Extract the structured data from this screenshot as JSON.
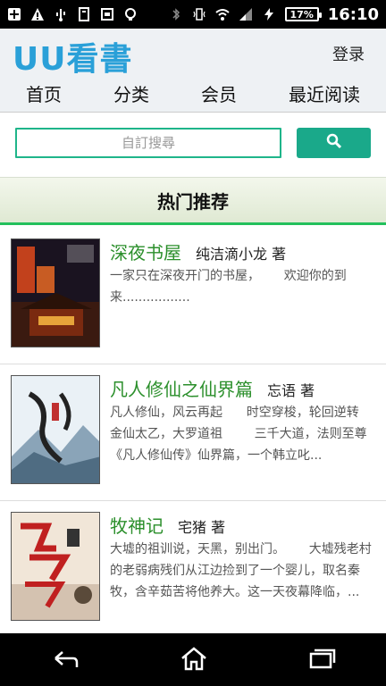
{
  "statusbar": {
    "battery": "17%",
    "time": "16:10"
  },
  "header": {
    "logo": "UU看書",
    "login": "登录"
  },
  "nav": {
    "items": [
      "首页",
      "分类",
      "会员",
      "最近阅读"
    ]
  },
  "search": {
    "placeholder": "自訂搜尋"
  },
  "section": {
    "title": "热门推荐"
  },
  "books": [
    {
      "title": "深夜书屋",
      "author": "纯洁滴小龙 著",
      "desc": "一家只在深夜开门的书屋，      欢迎你的到来................."
    },
    {
      "title": "凡人修仙之仙界篇",
      "author": "忘语 著",
      "desc": "凡人修仙，风云再起      时空穿梭，轮回逆转        金仙太乙，大罗道祖        三千大道，法则至尊      《凡人修仙传》仙界篇，一个韩立叱..."
    },
    {
      "title": "牧神记",
      "author": "宅猪 著",
      "desc": "大墟的祖训说，天黑，别出门。      大墟残老村的老弱病残们从江边捡到了一个婴儿，取名秦牧，含辛茹苦将他养大。这一天夜幕降临，..."
    }
  ]
}
